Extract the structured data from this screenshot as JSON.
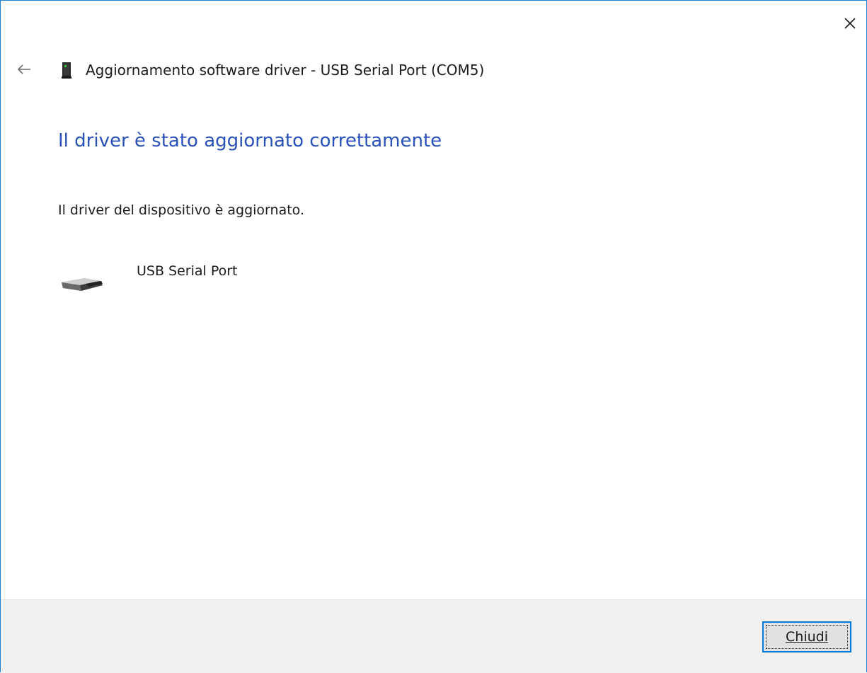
{
  "window": {
    "title": "Aggiornamento software driver - USB Serial Port (COM5)",
    "close_icon": "close-icon",
    "back_icon": "back-arrow-icon",
    "device_icon": "device-icon"
  },
  "content": {
    "heading": "Il driver è stato aggiornato correttamente",
    "status": "Il driver del dispositivo è aggiornato.",
    "device": {
      "icon": "usb-serial-port-icon",
      "name": "USB Serial Port"
    }
  },
  "footer": {
    "close_button_label": "Chiudi"
  },
  "colors": {
    "heading": "#2852b8",
    "window_border": "#1883d7",
    "footer_background": "#f0f0f0",
    "button_focus_border": "#0078d7"
  }
}
